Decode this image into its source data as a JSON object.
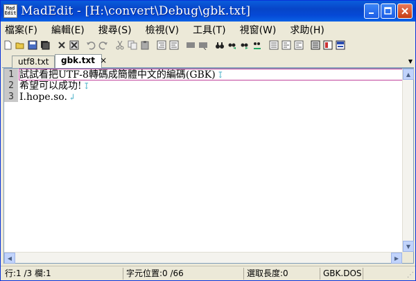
{
  "window": {
    "title": "MadEdit - [H:\\convert\\Debug\\gbk.txt]",
    "icon_text": "Mad Edit"
  },
  "menu": [
    "檔案(F)",
    "編輯(E)",
    "搜尋(S)",
    "檢視(V)",
    "工具(T)",
    "視窗(W)",
    "求助(H)"
  ],
  "toolbar_icons": [
    "new-icon",
    "open-icon",
    "save-icon",
    "save-all-icon",
    "close-icon",
    "close-all-icon",
    "undo-icon",
    "redo-icon",
    "cut-icon",
    "copy-icon",
    "paste-icon",
    "indent-icon",
    "unindent-icon",
    "comment-icon",
    "uncomment-icon",
    "find-icon",
    "find-next-icon",
    "find-prev-icon",
    "replace-icon",
    "wrap-none-icon",
    "wrap-window-icon",
    "wrap-column-icon",
    "text-mode-icon",
    "column-mode-icon",
    "hex-mode-icon"
  ],
  "tabs": [
    {
      "label": "utf8.txt",
      "active": false
    },
    {
      "label": "gbk.txt",
      "active": true,
      "close": "×"
    }
  ],
  "editor": {
    "lines": [
      {
        "num": "1",
        "text": "試試看把UTF-8轉碼成簡體中文的編碼(GBK)"
      },
      {
        "num": "2",
        "text": "希望可以成功!"
      },
      {
        "num": "3",
        "text": "I.hope.so."
      }
    ]
  },
  "status": {
    "position": "行:1 /3 欄:1",
    "char_pos": "字元位置:0 /66",
    "selection": "選取長度:0",
    "encoding": "GBK.DOS"
  },
  "colors": {
    "titlebar": "#0a5ddc",
    "current_line_border": "#c0409a",
    "whitespace_marker": "#4ab0c8",
    "gutter": "#c8c8c8"
  }
}
